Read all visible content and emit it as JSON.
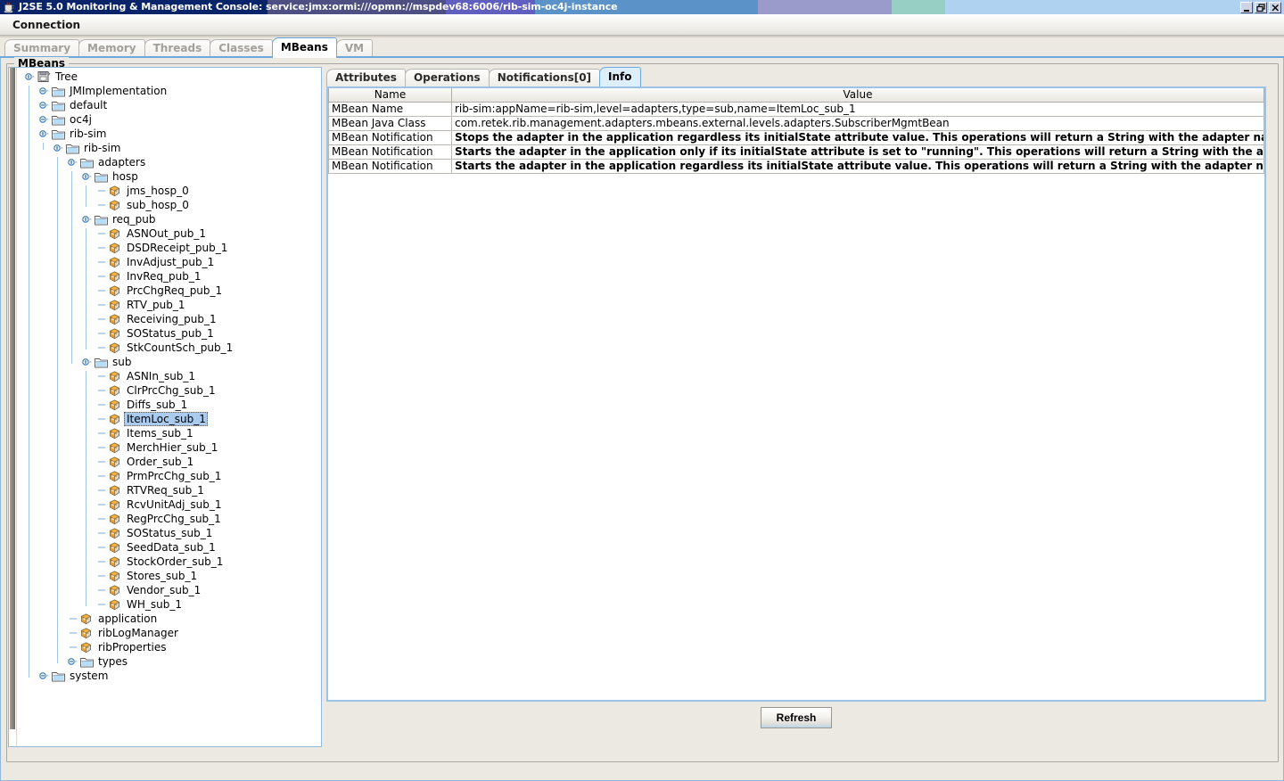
{
  "window": {
    "title": "J2SE 5.0 Monitoring & Management Console: service:jmx:ormi:///opmn://mspdev68:6006/rib-sim-oc4j-instance",
    "app_icon": "java-cup-icon",
    "controls": [
      {
        "name": "minimize-button",
        "glyph": "minimize"
      },
      {
        "name": "restore-button",
        "glyph": "restore"
      },
      {
        "name": "close-button",
        "glyph": "close"
      }
    ],
    "titlebar_colors": [
      "#0a246a",
      "#3d3f7a",
      "#5b5a87",
      "#5f62c4",
      "#5b93c9",
      "#9a9acb",
      "#97cfc4",
      "#aed2f0"
    ]
  },
  "menubar": {
    "items": [
      {
        "label": "Connection"
      }
    ]
  },
  "main_tabs": [
    {
      "label": "Summary",
      "selected": false
    },
    {
      "label": "Memory",
      "selected": false
    },
    {
      "label": "Threads",
      "selected": false
    },
    {
      "label": "Classes",
      "selected": false
    },
    {
      "label": "MBeans",
      "selected": true
    },
    {
      "label": "VM",
      "selected": false
    }
  ],
  "group": {
    "label": "MBeans"
  },
  "tree": {
    "root_label": "Tree",
    "root_icon": "tree-root-icon",
    "nodes": [
      {
        "label": "Tree",
        "depth": 0,
        "type": "root",
        "state": "expanded",
        "selected": false
      },
      {
        "label": "JMImplementation",
        "depth": 1,
        "type": "folder",
        "state": "collapsed",
        "selected": false
      },
      {
        "label": "default",
        "depth": 1,
        "type": "folder",
        "state": "collapsed",
        "selected": false
      },
      {
        "label": "oc4j",
        "depth": 1,
        "type": "folder",
        "state": "collapsed",
        "selected": false
      },
      {
        "label": "rib-sim",
        "depth": 1,
        "type": "folder",
        "state": "expanded",
        "selected": false
      },
      {
        "label": "rib-sim",
        "depth": 2,
        "type": "folder",
        "state": "expanded",
        "selected": false
      },
      {
        "label": "adapters",
        "depth": 3,
        "type": "folder",
        "state": "expanded",
        "selected": false
      },
      {
        "label": "hosp",
        "depth": 4,
        "type": "folder",
        "state": "expanded",
        "selected": false
      },
      {
        "label": "jms_hosp_0",
        "depth": 5,
        "type": "mbean",
        "state": "leaf",
        "selected": false
      },
      {
        "label": "sub_hosp_0",
        "depth": 5,
        "type": "mbean",
        "state": "leaf",
        "selected": false
      },
      {
        "label": "req_pub",
        "depth": 4,
        "type": "folder",
        "state": "expanded",
        "selected": false
      },
      {
        "label": "ASNOut_pub_1",
        "depth": 5,
        "type": "mbean",
        "state": "leaf",
        "selected": false
      },
      {
        "label": "DSDReceipt_pub_1",
        "depth": 5,
        "type": "mbean",
        "state": "leaf",
        "selected": false
      },
      {
        "label": "InvAdjust_pub_1",
        "depth": 5,
        "type": "mbean",
        "state": "leaf",
        "selected": false
      },
      {
        "label": "InvReq_pub_1",
        "depth": 5,
        "type": "mbean",
        "state": "leaf",
        "selected": false
      },
      {
        "label": "PrcChgReq_pub_1",
        "depth": 5,
        "type": "mbean",
        "state": "leaf",
        "selected": false
      },
      {
        "label": "RTV_pub_1",
        "depth": 5,
        "type": "mbean",
        "state": "leaf",
        "selected": false
      },
      {
        "label": "Receiving_pub_1",
        "depth": 5,
        "type": "mbean",
        "state": "leaf",
        "selected": false
      },
      {
        "label": "SOStatus_pub_1",
        "depth": 5,
        "type": "mbean",
        "state": "leaf",
        "selected": false
      },
      {
        "label": "StkCountSch_pub_1",
        "depth": 5,
        "type": "mbean",
        "state": "leaf",
        "selected": false
      },
      {
        "label": "sub",
        "depth": 4,
        "type": "folder",
        "state": "expanded",
        "selected": false
      },
      {
        "label": "ASNIn_sub_1",
        "depth": 5,
        "type": "mbean",
        "state": "leaf",
        "selected": false
      },
      {
        "label": "ClrPrcChg_sub_1",
        "depth": 5,
        "type": "mbean",
        "state": "leaf",
        "selected": false
      },
      {
        "label": "Diffs_sub_1",
        "depth": 5,
        "type": "mbean",
        "state": "leaf",
        "selected": false
      },
      {
        "label": "ItemLoc_sub_1",
        "depth": 5,
        "type": "mbean",
        "state": "leaf",
        "selected": true
      },
      {
        "label": "Items_sub_1",
        "depth": 5,
        "type": "mbean",
        "state": "leaf",
        "selected": false
      },
      {
        "label": "MerchHier_sub_1",
        "depth": 5,
        "type": "mbean",
        "state": "leaf",
        "selected": false
      },
      {
        "label": "Order_sub_1",
        "depth": 5,
        "type": "mbean",
        "state": "leaf",
        "selected": false
      },
      {
        "label": "PrmPrcChg_sub_1",
        "depth": 5,
        "type": "mbean",
        "state": "leaf",
        "selected": false
      },
      {
        "label": "RTVReq_sub_1",
        "depth": 5,
        "type": "mbean",
        "state": "leaf",
        "selected": false
      },
      {
        "label": "RcvUnitAdj_sub_1",
        "depth": 5,
        "type": "mbean",
        "state": "leaf",
        "selected": false
      },
      {
        "label": "RegPrcChg_sub_1",
        "depth": 5,
        "type": "mbean",
        "state": "leaf",
        "selected": false
      },
      {
        "label": "SOStatus_sub_1",
        "depth": 5,
        "type": "mbean",
        "state": "leaf",
        "selected": false
      },
      {
        "label": "SeedData_sub_1",
        "depth": 5,
        "type": "mbean",
        "state": "leaf",
        "selected": false
      },
      {
        "label": "StockOrder_sub_1",
        "depth": 5,
        "type": "mbean",
        "state": "leaf",
        "selected": false
      },
      {
        "label": "Stores_sub_1",
        "depth": 5,
        "type": "mbean",
        "state": "leaf",
        "selected": false
      },
      {
        "label": "Vendor_sub_1",
        "depth": 5,
        "type": "mbean",
        "state": "leaf",
        "selected": false
      },
      {
        "label": "WH_sub_1",
        "depth": 5,
        "type": "mbean",
        "state": "leaf",
        "selected": false
      },
      {
        "label": "application",
        "depth": 3,
        "type": "mbean",
        "state": "leaf",
        "selected": false
      },
      {
        "label": "ribLogManager",
        "depth": 3,
        "type": "mbean",
        "state": "leaf",
        "selected": false
      },
      {
        "label": "ribProperties",
        "depth": 3,
        "type": "mbean",
        "state": "leaf",
        "selected": false
      },
      {
        "label": "types",
        "depth": 3,
        "type": "folder",
        "state": "collapsed",
        "selected": false
      },
      {
        "label": "system",
        "depth": 1,
        "type": "folder",
        "state": "collapsed",
        "selected": false
      }
    ]
  },
  "detail_tabs": [
    {
      "label": "Attributes",
      "selected": false
    },
    {
      "label": "Operations",
      "selected": false
    },
    {
      "label": "Notifications[0]",
      "selected": false
    },
    {
      "label": "Info",
      "selected": true
    }
  ],
  "table": {
    "columns": [
      "Name",
      "Value"
    ],
    "rows": [
      {
        "name": "MBean Name",
        "value": "rib-sim:appName=rib-sim,level=adapters,type=sub,name=ItemLoc_sub_1",
        "bold": false
      },
      {
        "name": "MBean Java Class",
        "value": "com.retek.rib.management.adapters.mbeans.external.levels.adapters.SubscriberMgmtBean",
        "bold": false
      },
      {
        "name": "MBean Notification",
        "value": "Stops the adapter in the application regardless its initialState  attribute value. This operations will return a String with the adapter  name and its state after invo...",
        "bold": true
      },
      {
        "name": "MBean Notification",
        "value": "Starts the adapter in the application only if its initialState attribute  is set to \"running\". This operations will return a String with the  adapter name and its state af...",
        "bold": true
      },
      {
        "name": "MBean Notification",
        "value": "Starts the adapter in the application regardless its initialState  attribute value. This operations will return a String with the adapter  name and its state after invo...",
        "bold": true
      }
    ]
  },
  "refresh": {
    "label": "Refresh"
  }
}
